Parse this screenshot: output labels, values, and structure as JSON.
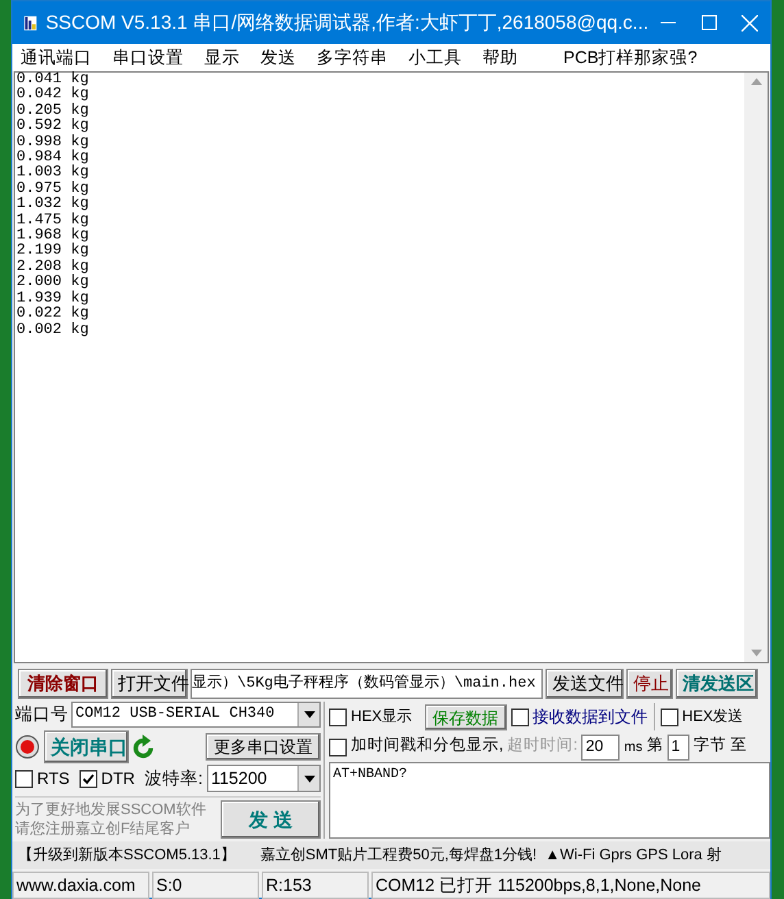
{
  "window": {
    "title": "SSCOM V5.13.1 串口/网络数据调试器,作者:大虾丁丁,2618058@qq.c..."
  },
  "menu": [
    "通讯端口",
    "串口设置",
    "显示",
    "发送",
    "多字符串",
    "小工具",
    "帮助",
    "PCB打样那家强?"
  ],
  "receive_lines": [
    "0.041 kg",
    "0.042 kg",
    "0.205 kg",
    "0.592 kg",
    "0.998 kg",
    "0.984 kg",
    "1.003 kg",
    "0.975 kg",
    "1.032 kg",
    "1.475 kg",
    "1.968 kg",
    "2.199 kg",
    "2.208 kg",
    "2.000 kg",
    "1.939 kg",
    "0.022 kg",
    "0.002 kg"
  ],
  "toolbar": {
    "clear_button": "清除窗口",
    "open_file_button": "打开文件",
    "file_path": "显示）\\5Kg电子秤程序（数码管显示）\\main.hex",
    "send_file_button": "发送文件",
    "stop_button": "停止",
    "clear_send_button": "清发送区"
  },
  "port": {
    "label": "端口号",
    "value": "COM12 USB-SERIAL CH340"
  },
  "port_open": true,
  "close_port_button": "关闭串口",
  "more_settings_button": "更多串口设置",
  "rts": {
    "label": "RTS",
    "checked": false
  },
  "dtr": {
    "label": "DTR",
    "checked": true
  },
  "baud": {
    "label": "波特率:",
    "value": "115200"
  },
  "promo": [
    "为了更好地发展SSCOM软件",
    "请您注册嘉立创F结尾客户"
  ],
  "send_button": "发 送",
  "hex_display": {
    "label": "HEX显示",
    "checked": false
  },
  "save_data_button": "保存数据",
  "receive_to_file": {
    "label": "接收数据到文件",
    "checked": false
  },
  "hex_send": {
    "label": "HEX发送",
    "checked": false
  },
  "timestamp": {
    "label": "加时间戳和分包显示,",
    "checked": false
  },
  "timeout": {
    "label": "超时时间:",
    "value": "20",
    "unit": "ms"
  },
  "byte_range": {
    "from_label": "第",
    "from": "1",
    "unit": "字节",
    "to_label": "至"
  },
  "send_text": "AT+NBAND?",
  "ad_bar": [
    "【升级到新版本SSCOM5.13.1】",
    "嘉立创SMT贴片工程费50元,每焊盘1分钱!",
    "▲Wi-Fi Gprs GPS Lora 射"
  ],
  "status": [
    "www.daxia.com",
    "S:0",
    "R:153",
    "COM12 已打开  115200bps,8,1,None,None"
  ]
}
